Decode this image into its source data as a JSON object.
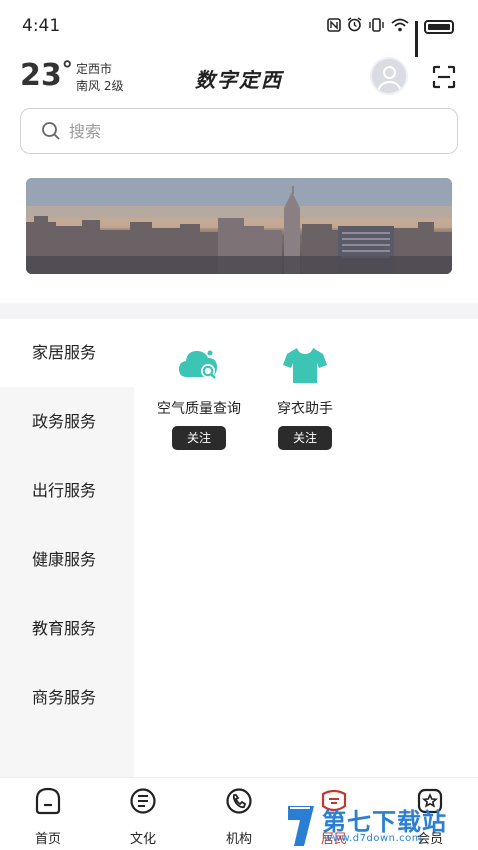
{
  "status_bar": {
    "time": "4:41",
    "icons": [
      "nfc-icon",
      "alarm-icon",
      "vibrate-icon",
      "wifi-icon",
      "signal-icon",
      "battery-icon"
    ]
  },
  "header": {
    "temperature": "23",
    "degree": "°",
    "city": "定西市",
    "wind": "南风  2级",
    "title": "数字定西"
  },
  "search": {
    "placeholder": "搜索"
  },
  "categories": [
    {
      "label": "家居服务",
      "active": true
    },
    {
      "label": "政务服务",
      "active": false
    },
    {
      "label": "出行服务",
      "active": false
    },
    {
      "label": "健康服务",
      "active": false
    },
    {
      "label": "教育服务",
      "active": false
    },
    {
      "label": "商务服务",
      "active": false
    }
  ],
  "services": [
    {
      "label": "空气质量查询",
      "follow_label": "关注",
      "icon": "cloud-search-icon",
      "color": "#3cc4b4"
    },
    {
      "label": "穿衣助手",
      "follow_label": "关注",
      "icon": "tshirt-icon",
      "color": "#3cc4b4"
    }
  ],
  "bottom_nav": [
    {
      "label": "首页",
      "icon": "home-icon",
      "active": false
    },
    {
      "label": "文化",
      "icon": "culture-icon",
      "active": false
    },
    {
      "label": "机构",
      "icon": "phone-icon",
      "active": false
    },
    {
      "label": "居民",
      "icon": "resident-icon",
      "active": true
    },
    {
      "label": "会员",
      "icon": "member-icon",
      "active": false
    }
  ],
  "watermark": {
    "text": "第七下载站",
    "url": "www.d7down.com"
  },
  "colors": {
    "accent": "#3cc4b4",
    "active_nav": "#c0392b",
    "follow_button": "#2b2b2b",
    "watermark": "#2a7fd4"
  }
}
